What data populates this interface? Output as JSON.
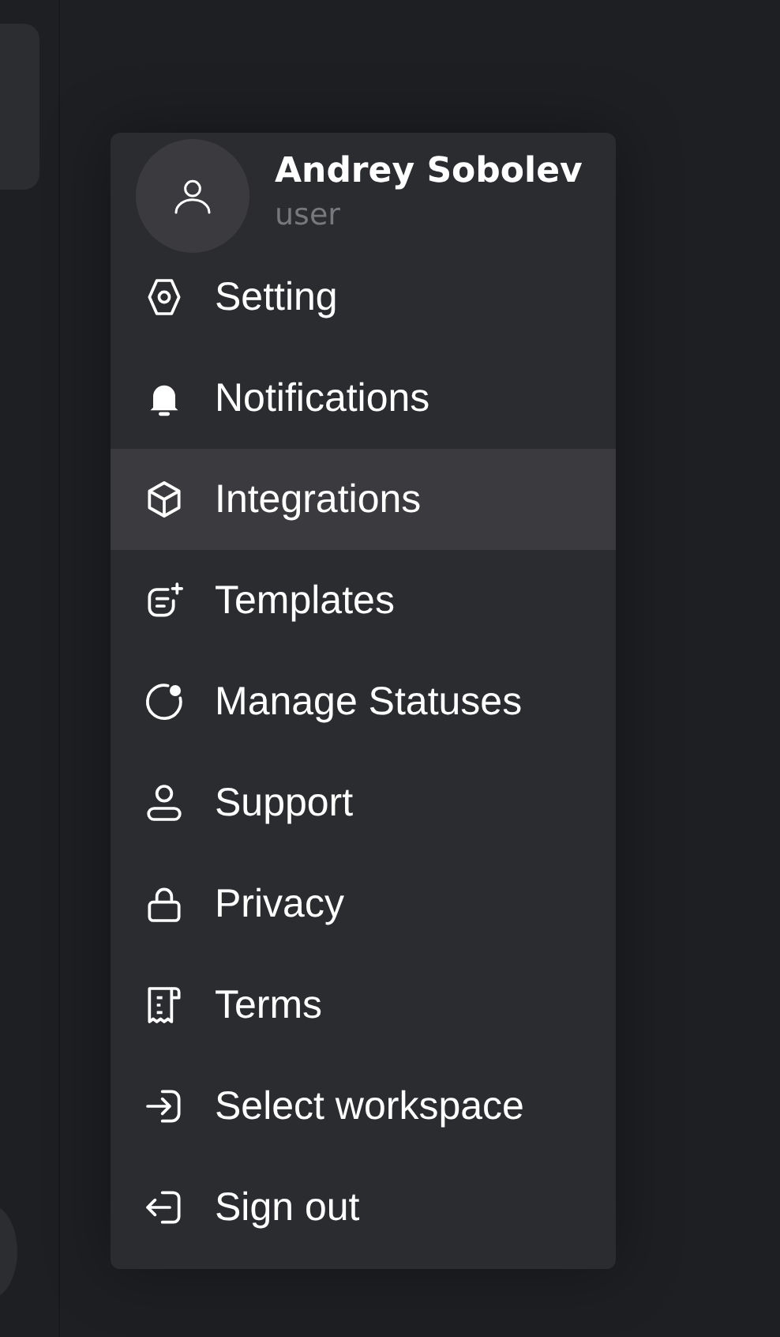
{
  "profile": {
    "name": "Andrey Sobolev",
    "role": "user"
  },
  "menu": [
    {
      "label": "Setting",
      "selected": false
    },
    {
      "label": "Notifications",
      "selected": false
    },
    {
      "label": "Integrations",
      "selected": true
    },
    {
      "label": "Templates",
      "selected": false
    },
    {
      "label": "Manage Statuses",
      "selected": false
    },
    {
      "label": "Support",
      "selected": false
    },
    {
      "label": "Privacy",
      "selected": false
    },
    {
      "label": "Terms",
      "selected": false
    },
    {
      "label": "Select workspace",
      "selected": false
    },
    {
      "label": "Sign out",
      "selected": false
    }
  ]
}
